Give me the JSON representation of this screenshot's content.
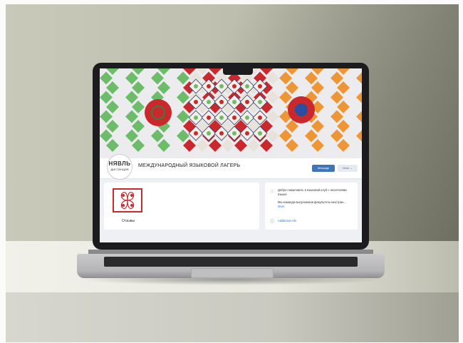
{
  "page": {
    "group_logo": {
      "top": "НЯВЛЬ",
      "bottom": "ДИСТАНЦИЯ"
    },
    "group_name": "МЕЖДУНАРОДНЫЙ ЯЗЫКОВОЙ ЛАГЕРЬ",
    "buttons": {
      "message": "Message",
      "more": "More ⌄"
    },
    "reviews_label": "Отзывы",
    "info": {
      "welcome": "Добро пожаловать в языковой клуб с носителями языка!",
      "description": "Мы команда выпускников факультета иностран...",
      "more_link": "More",
      "additional": "Additional info"
    }
  },
  "colors": {
    "green": "#6cbc6a",
    "red": "#c9282d",
    "orange": "#ee9536",
    "navy": "#2c3e73",
    "accent_blue": "#3f74b9"
  }
}
